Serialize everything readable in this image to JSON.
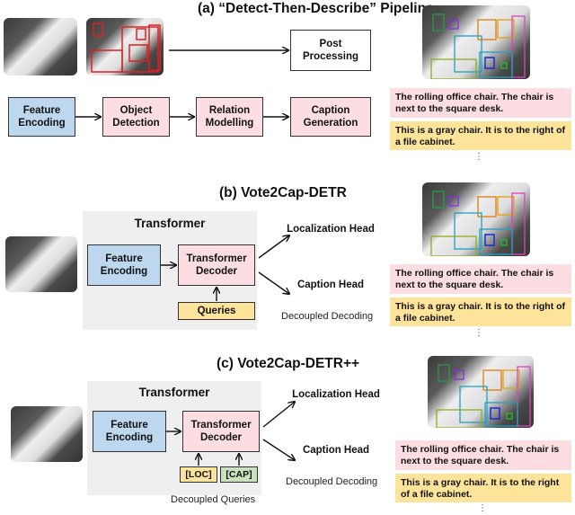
{
  "panels": {
    "a": {
      "title": "(a) “Detect-Then-Describe” Pipeline",
      "post_processing": "Post Processing",
      "stages": [
        "Feature Encoding",
        "Object Detection",
        "Relation Modelling",
        "Caption Generation"
      ],
      "captions": [
        "The rolling office chair. The chair is next to the square desk.",
        "This is a gray chair. It is to the right of a file cabinet."
      ],
      "ellipsis": "⋮"
    },
    "b": {
      "title": "(b) Vote2Cap-DETR",
      "transformer_label": "Transformer",
      "feature_encoding": "Feature Encoding",
      "transformer_decoder": "Transformer Decoder",
      "queries": "Queries",
      "localization_head": "Localization Head",
      "caption_head": "Caption Head",
      "decoupled_decoding": "Decoupled Decoding",
      "captions": [
        "The rolling office chair. The chair is next to the square desk.",
        "This is a gray chair. It is to the right of a file cabinet."
      ],
      "ellipsis": "⋮"
    },
    "c": {
      "title": "(c) Vote2Cap-DETR++",
      "transformer_label": "Transformer",
      "feature_encoding": "Feature Encoding",
      "transformer_decoder": "Transformer Decoder",
      "loc_query": "[LOC]",
      "cap_query": "[CAP]",
      "decoupled_queries": "Decoupled Queries",
      "localization_head": "Localization Head",
      "caption_head": "Caption Head",
      "decoupled_decoding": "Decoupled Decoding",
      "captions": [
        "The rolling office chair. The chair is next to the square desk.",
        "This is a gray chair. It is to the right of a file cabinet."
      ],
      "ellipsis": "⋮"
    }
  },
  "colors": {
    "encoding_blue": "#bdd7ee",
    "module_pink": "#fcdde2",
    "query_yellow": "#fde49a",
    "query_green": "#c7e3bd",
    "panel_gray": "#efefef",
    "detection_red": "#e02020"
  }
}
